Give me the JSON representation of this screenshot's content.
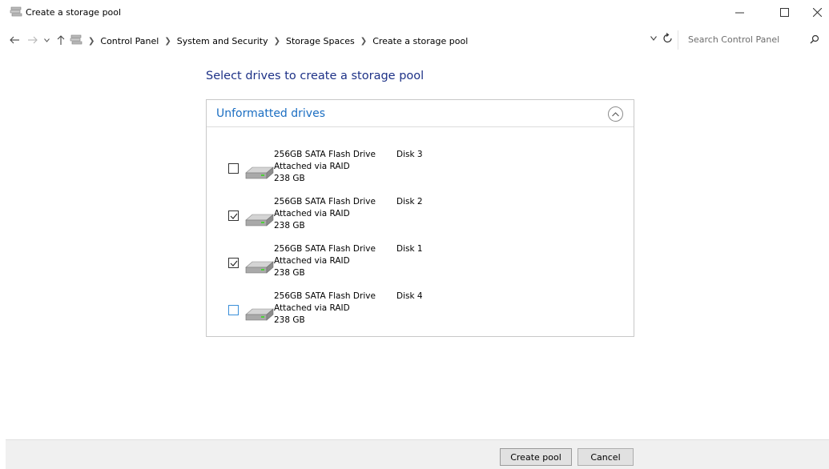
{
  "window": {
    "title": "Create a storage pool",
    "app_icon": "storage-spaces-icon",
    "controls": [
      "minimize-icon",
      "maximize-icon",
      "close-icon"
    ]
  },
  "nav": {
    "back_icon": "arrow-left-icon",
    "forward_icon": "arrow-right-icon",
    "recent_icon": "chevron-down-icon",
    "up_icon": "arrow-up-icon",
    "breadcrumb": [
      "Control Panel",
      "System and Security",
      "Storage Spaces",
      "Create a storage pool"
    ],
    "search_placeholder": "Search Control Panel"
  },
  "main": {
    "heading": "Select drives to create a storage pool",
    "group_title": "Unformatted drives",
    "drives": [
      {
        "name": "256GB SATA Flash Drive",
        "connection": "Attached via RAID",
        "size": "238 GB",
        "disk": "Disk 3",
        "checked": false
      },
      {
        "name": "256GB SATA Flash Drive",
        "connection": "Attached via RAID",
        "size": "238 GB",
        "disk": "Disk 2",
        "checked": true
      },
      {
        "name": "256GB SATA Flash Drive",
        "connection": "Attached via RAID",
        "size": "238 GB",
        "disk": "Disk 1",
        "checked": true
      },
      {
        "name": "256GB SATA Flash Drive",
        "connection": "Attached via RAID",
        "size": "238 GB",
        "disk": "Disk 4",
        "checked": false
      }
    ]
  },
  "footer": {
    "create_label": "Create pool",
    "cancel_label": "Cancel"
  },
  "colors": {
    "heading": "#1e3287",
    "group_title": "#1b6ec2",
    "footer_bg": "#f0f0f0"
  }
}
